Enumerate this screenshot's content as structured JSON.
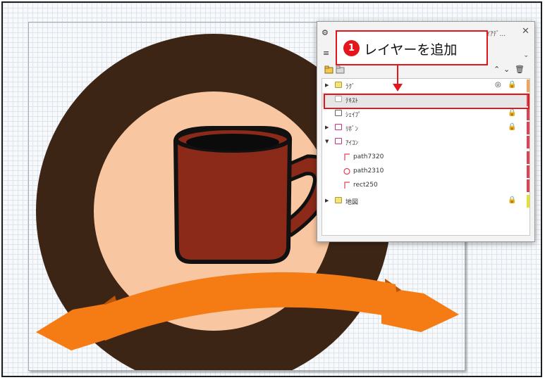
{
  "panel": {
    "title": "ｾｲｱﾃﾞ...",
    "close": "✕",
    "grip_icon": "gear-icon",
    "row2_icon": "layers-icon",
    "chevron": "⌄",
    "toolbar_up": "⌃",
    "toolbar_down": "⌄",
    "layers": [
      {
        "label": "ﾗｸﾞ",
        "expanded": false,
        "locked": true,
        "hidden": true,
        "tag_color": "#f3a25a"
      },
      {
        "label": "ﾃｷｽﾄ",
        "expanded": false,
        "locked": false,
        "hidden": false,
        "tag_color": "#e04050"
      },
      {
        "label": "ｼｪｲﾌﾟ",
        "expanded": false,
        "locked": true,
        "hidden": false,
        "tag_color": "#e04050"
      },
      {
        "label": "ﾘﾎﾞﾝ",
        "expanded": false,
        "locked": true,
        "hidden": false,
        "tag_color": "#e04050"
      },
      {
        "label": "ｱｲｺﾝ",
        "expanded": true,
        "locked": false,
        "hidden": false,
        "tag_color": "#e04050"
      },
      {
        "label": "path7320",
        "child": true,
        "kind": "path",
        "tag_color": "#e04050"
      },
      {
        "label": "path2310",
        "child": true,
        "kind": "circle",
        "tag_color": "#e04050"
      },
      {
        "label": "rect250",
        "child": true,
        "kind": "path",
        "tag_color": "#e04050"
      },
      {
        "label": "地図",
        "expanded": false,
        "locked": true,
        "hidden": false,
        "tag_color": "#e8e030"
      }
    ]
  },
  "callout": {
    "number": "1",
    "text": "レイヤーを追加"
  },
  "colors": {
    "accent": "#e3161b",
    "ring": "#3d2516",
    "peach": "#f8c6a0",
    "mug": "#8b2a18",
    "ribbon": "#f57b15"
  }
}
